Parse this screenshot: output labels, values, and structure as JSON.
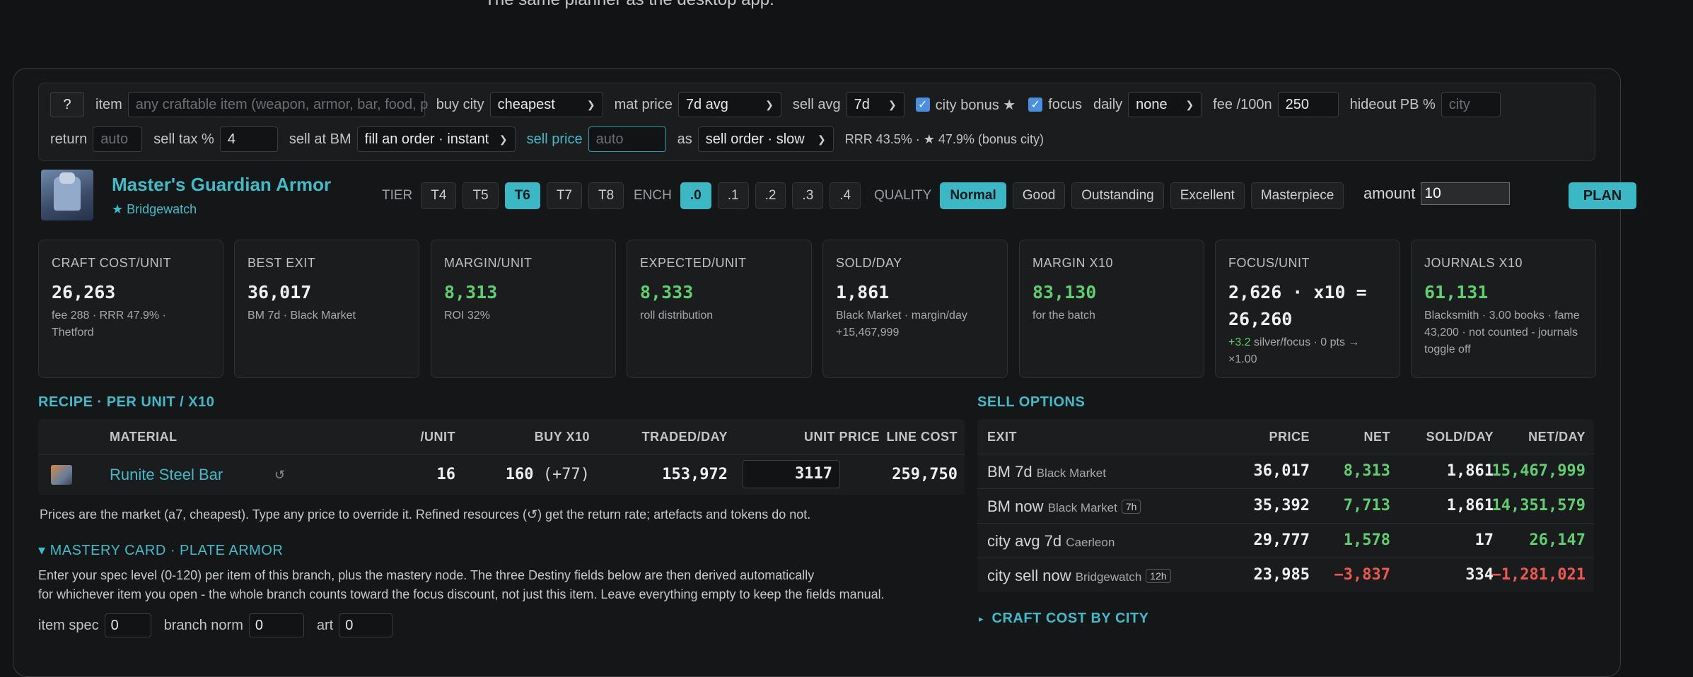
{
  "caption": "The same planner as the desktop app.",
  "controls": {
    "help_label": "?",
    "item_label": "item",
    "item_placeholder": "any craftable item (weapon, armor, bar, food, p",
    "buy_city_label": "buy city",
    "buy_city_value": "cheapest",
    "mat_price_label": "mat price",
    "mat_price_value": "7d avg",
    "sell_avg_label": "sell avg",
    "sell_avg_value": "7d",
    "city_bonus_label": "city bonus ★",
    "city_bonus_checked": true,
    "focus_label": "focus",
    "focus_checked": true,
    "daily_label": "daily",
    "daily_value": "none",
    "fee_label": "fee /100n",
    "fee_value": "250",
    "hideout_label": "hideout PB %",
    "hideout_placeholder": "city",
    "return_label": "return",
    "return_placeholder": "auto",
    "sell_tax_label": "sell tax %",
    "sell_tax_value": "4",
    "sell_at_bm_label": "sell at BM",
    "sell_at_bm_value": "fill an order · instant",
    "sell_price_label": "sell price",
    "sell_price_placeholder": "auto",
    "as_label": "as",
    "as_value": "sell order · slow",
    "rrr_text": "RRR 43.5% · ★ 47.9% (bonus city)"
  },
  "item": {
    "name": "Master's Guardian Armor",
    "city": "★ Bridgewatch",
    "tier_label": "TIER",
    "tiers": [
      "T4",
      "T5",
      "T6",
      "T7",
      "T8"
    ],
    "tier_selected": "T6",
    "ench_label": "ENCH",
    "enchants": [
      ".0",
      ".1",
      ".2",
      ".3",
      ".4"
    ],
    "ench_selected": ".0",
    "quality_label": "QUALITY",
    "qualities": [
      "Normal",
      "Good",
      "Outstanding",
      "Excellent",
      "Masterpiece"
    ],
    "quality_selected": "Normal",
    "amount_label": "amount",
    "amount_value": "10",
    "plan_label": "PLAN"
  },
  "stats": [
    {
      "title": "CRAFT COST/UNIT",
      "value": "26,263",
      "sub": "fee 288 · RRR 47.9% · Thetford"
    },
    {
      "title": "BEST EXIT",
      "value": "36,017",
      "sub": "BM 7d · Black Market"
    },
    {
      "title": "MARGIN/UNIT",
      "value": "8,313",
      "sub": "ROI 32%"
    },
    {
      "title": "EXPECTED/UNIT",
      "value": "8,333",
      "sub": "roll distribution"
    },
    {
      "title": "SOLD/DAY",
      "value": "1,861",
      "sub": "Black Market · margin/day +15,467,999"
    },
    {
      "title": "MARGIN X10",
      "value": "83,130",
      "sub": "for the batch"
    },
    {
      "title": "FOCUS/UNIT",
      "value": "2,626 · x10 = 26,260",
      "sub_a": "+3.2",
      "sub_b": " silver/focus · 0 pts → ×1.00"
    },
    {
      "title": "JOURNALS X10",
      "value": "61,131",
      "sub": "Blacksmith · 3.00 books · fame 43,200 · not counted - journals toggle off"
    }
  ],
  "recipe": {
    "title": "RECIPE · PER UNIT / X10",
    "headers": [
      "MATERIAL",
      "/UNIT",
      "BUY X10",
      "TRADED/DAY",
      "UNIT PRICE",
      "LINE COST"
    ],
    "rows": [
      {
        "material": "Runite Steel Bar",
        "refresh": "↺",
        "per_unit": "16",
        "buy": "160",
        "buy_extra": "(+77)",
        "traded": "153,972",
        "unit_price": "3117",
        "line_cost": "259,750"
      }
    ],
    "note": "Prices are the market (a7, cheapest). Type any price to override it. Refined resources (↺) get the return rate; artefacts and tokens do not."
  },
  "mastery": {
    "title": "▾ MASTERY CARD · PLATE ARMOR",
    "desc1": "Enter your spec level (0-120) per item of this branch, plus the mastery node. The three Destiny fields below are then derived automatically",
    "desc2": "for whichever item you open - the whole branch counts toward the focus discount, not just this item. Leave everything empty to keep the fields manual.",
    "item_spec_label": "item spec",
    "item_spec_value": "0",
    "branch_norm_label": "branch norm",
    "branch_norm_value": "0",
    "art_label": "art",
    "art_value": "0"
  },
  "sell": {
    "title": "SELL OPTIONS",
    "headers": [
      "EXIT",
      "PRICE",
      "NET",
      "SOLD/DAY",
      "NET/DAY"
    ],
    "rows": [
      {
        "exit": "BM 7d",
        "place": "Black Market",
        "badge": "",
        "price": "36,017",
        "net": "8,313",
        "sold": "1,861",
        "netday": "15,467,999",
        "neg": false
      },
      {
        "exit": "BM now",
        "place": "Black Market",
        "badge": "7h",
        "price": "35,392",
        "net": "7,713",
        "sold": "1,861",
        "netday": "14,351,579",
        "neg": false
      },
      {
        "exit": "city avg 7d",
        "place": "Caerleon",
        "badge": "",
        "price": "29,777",
        "net": "1,578",
        "sold": "17",
        "netday": "26,147",
        "neg": false
      },
      {
        "exit": "city sell now",
        "place": "Bridgewatch",
        "badge": "12h",
        "price": "23,985",
        "net": "−3,837",
        "sold": "334",
        "netday": "−1,281,021",
        "neg": true
      }
    ],
    "craft_cost_by_city": "CRAFT COST BY CITY",
    "craft_cost_arrow": "▸"
  }
}
